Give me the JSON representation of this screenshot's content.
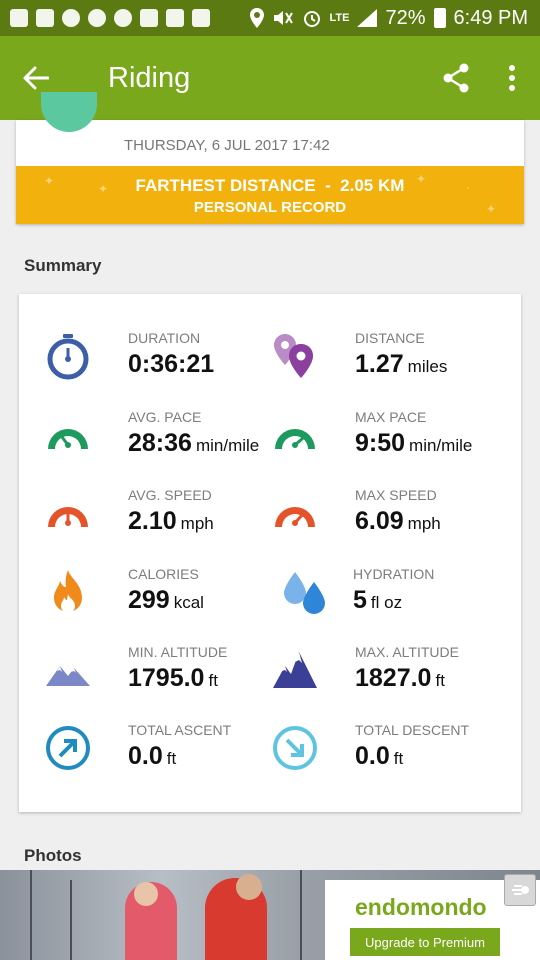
{
  "status_bar": {
    "left_icons": [
      "flipboard-icon",
      "facebook-icon",
      "messenger-icon",
      "snapchat-icon",
      "pinterest-icon",
      "mail-icon",
      "gallery-icon",
      "photo-icon"
    ],
    "network": "LTE",
    "battery": "72%",
    "time": "6:49 PM"
  },
  "header": {
    "title": "Riding"
  },
  "workout": {
    "date": "THURSDAY, 6 JUL 2017 17:42",
    "record_title": "FARTHEST DISTANCE  -  2.05 KM",
    "record_subtitle": "PERSONAL RECORD"
  },
  "summary": {
    "title": "Summary",
    "stats": [
      {
        "label": "DURATION",
        "value": "0:36:21",
        "unit": "",
        "icon": "stopwatch-icon",
        "color": "#3d5fa8"
      },
      {
        "label": "DISTANCE",
        "value": "1.27",
        "unit": "miles",
        "icon": "location-pins-icon",
        "color": "#8b3f9e"
      },
      {
        "label": "AVG. PACE",
        "value": "28:36",
        "unit": "min/mile",
        "icon": "avg-pace-gauge-icon",
        "color": "#1e9a5e"
      },
      {
        "label": "MAX PACE",
        "value": "9:50",
        "unit": "min/mile",
        "icon": "max-pace-gauge-icon",
        "color": "#1e9a5e"
      },
      {
        "label": "AVG. SPEED",
        "value": "2.10",
        "unit": "mph",
        "icon": "avg-speed-gauge-icon",
        "color": "#e5532b"
      },
      {
        "label": "MAX SPEED",
        "value": "6.09",
        "unit": "mph",
        "icon": "max-speed-gauge-icon",
        "color": "#e5532b"
      },
      {
        "label": "CALORIES",
        "value": "299",
        "unit": "kcal",
        "icon": "flame-icon",
        "color": "#f08a1a"
      },
      {
        "label": "HYDRATION",
        "value": "5",
        "unit": "fl oz",
        "icon": "water-drops-icon",
        "color": "#2f86d8"
      },
      {
        "label": "MIN. ALTITUDE",
        "value": "1795.0",
        "unit": "ft",
        "icon": "min-altitude-mountain-icon",
        "color": "#7c87c8"
      },
      {
        "label": "MAX. ALTITUDE",
        "value": "1827.0",
        "unit": "ft",
        "icon": "max-altitude-mountain-icon",
        "color": "#3b3f96"
      },
      {
        "label": "TOTAL ASCENT",
        "value": "0.0",
        "unit": "ft",
        "icon": "ascent-arrow-icon",
        "color": "#1f8bc0"
      },
      {
        "label": "TOTAL DESCENT",
        "value": "0.0",
        "unit": "ft",
        "icon": "descent-arrow-icon",
        "color": "#5fc4e0"
      }
    ]
  },
  "photos": {
    "title": "Photos"
  },
  "ad": {
    "brand": "endomondo",
    "cta": "Upgrade to Premium"
  },
  "colors": {
    "status_bar": "#5b7a12",
    "app_bar": "#7aa81c",
    "record_banner": "#f2b10d"
  }
}
